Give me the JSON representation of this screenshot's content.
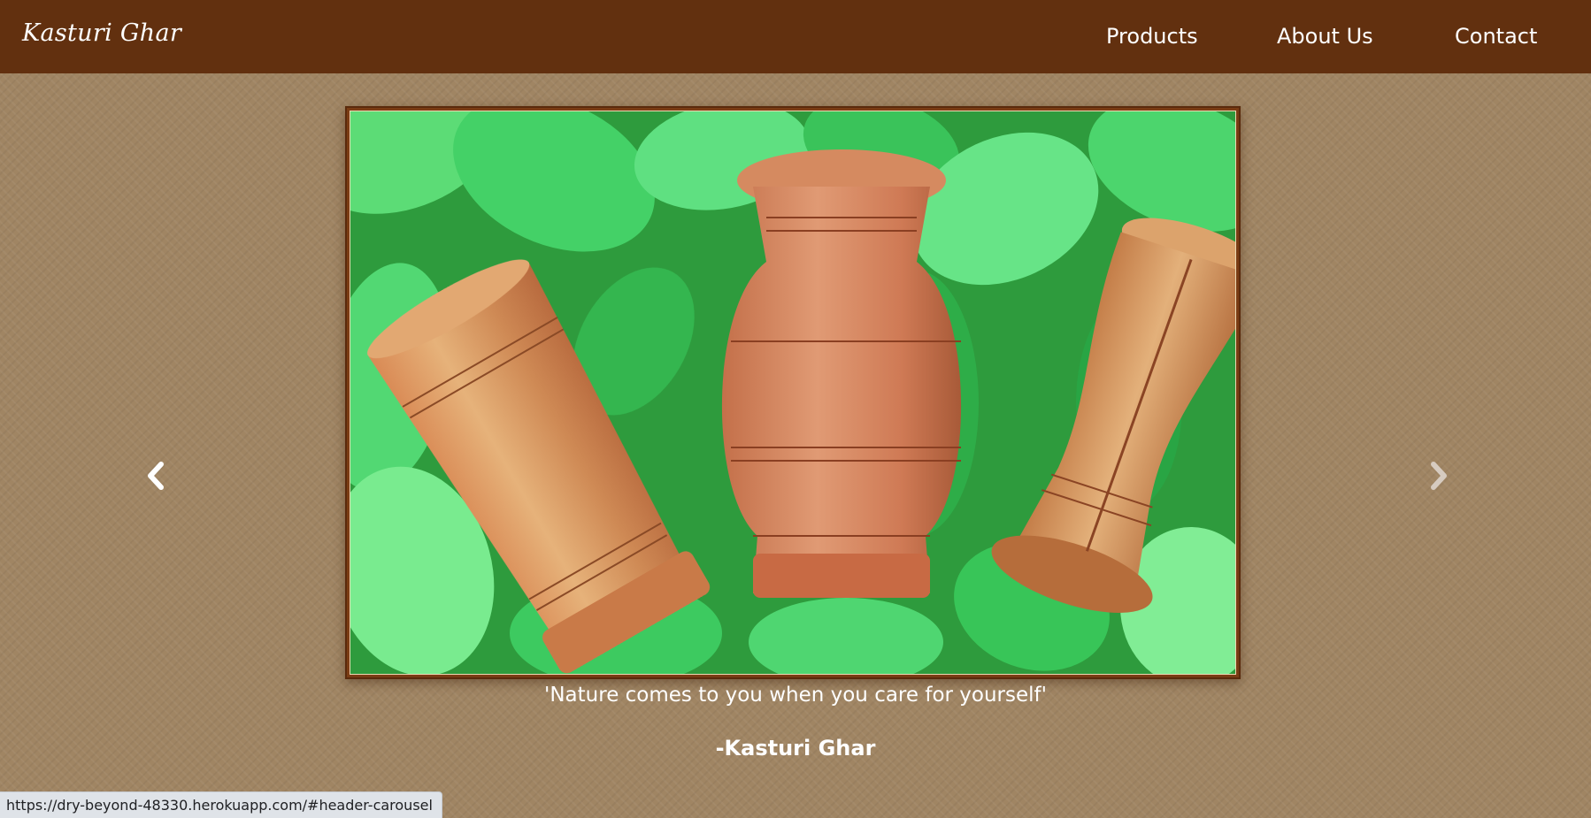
{
  "navbar": {
    "brand": "Kasturi Ghar",
    "links": [
      {
        "label": "Products"
      },
      {
        "label": "About Us"
      },
      {
        "label": "Contact"
      }
    ],
    "background_color": "#62300f"
  },
  "carousel": {
    "slide_image": "three turned wooden vases on green leaves",
    "prev_icon": "chevron-left-icon",
    "next_icon": "chevron-right-icon",
    "caption_quote": "'Nature comes to you when you care for yourself'",
    "caption_author": "-Kasturi Ghar"
  },
  "status_bar": {
    "url": "https://dry-beyond-48330.herokuapp.com/#header-carousel"
  },
  "colors": {
    "page_background": "#a08563",
    "frame_border": "#7a3c14",
    "text": "#ffffff"
  }
}
